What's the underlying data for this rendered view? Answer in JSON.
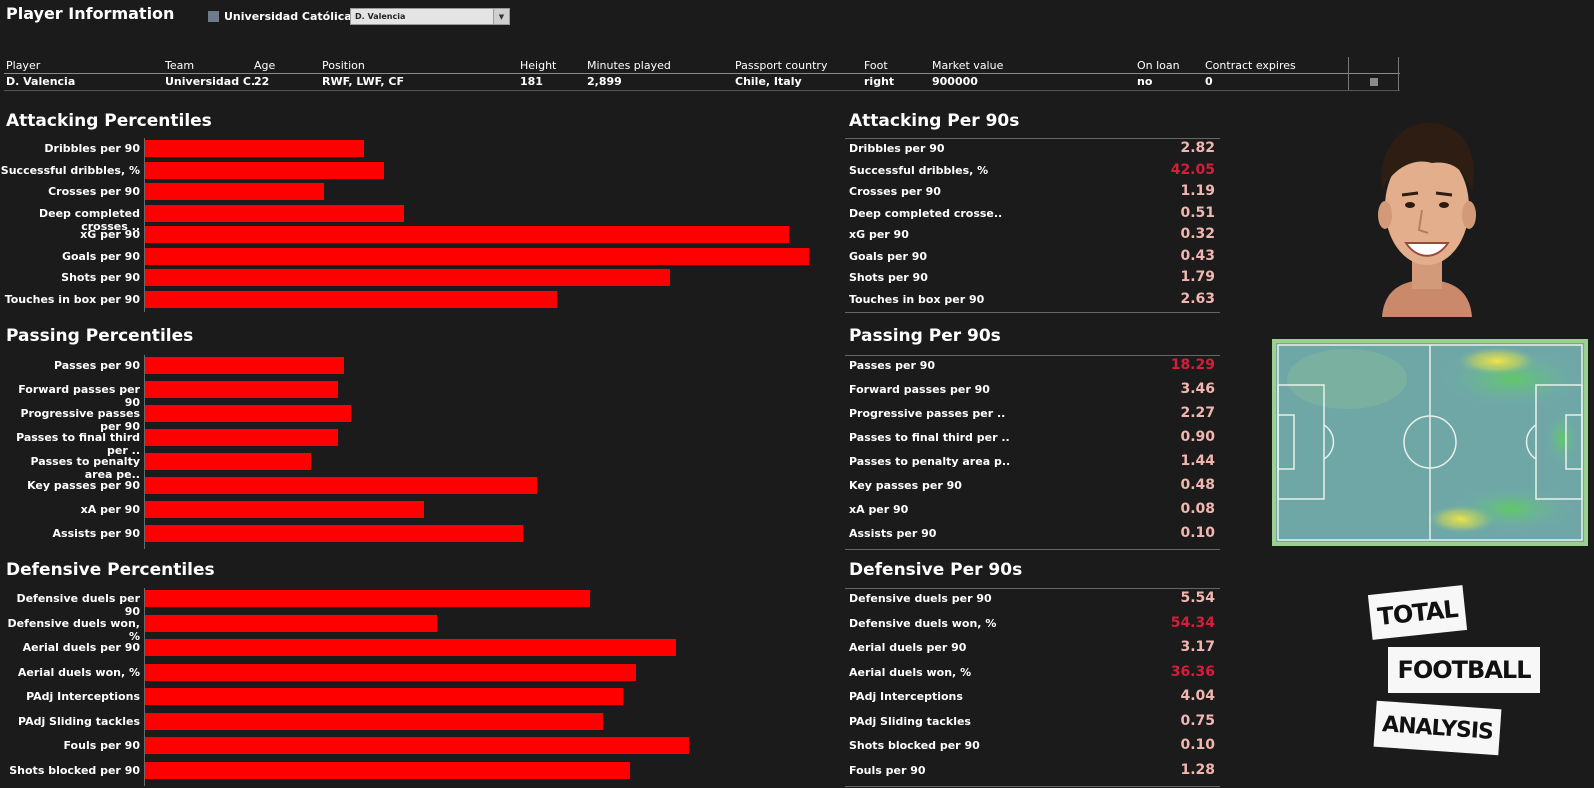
{
  "page_title": "Player Information",
  "team_filter": {
    "label": "Universidad Católica",
    "color": "#6d7b8a"
  },
  "player_select": {
    "value": "D. Valencia"
  },
  "info": {
    "headers": [
      "Player",
      "Team",
      "Age",
      "Position",
      "Height",
      "Minutes played",
      "Passport country",
      "Foot",
      "Market value",
      "On loan",
      "Contract expires"
    ],
    "values": [
      "D. Valencia",
      "Universidad C..",
      "22",
      "RWF, LWF, CF",
      "181",
      "2,899",
      "Chile, Italy",
      "right",
      "900000",
      "no",
      "0"
    ]
  },
  "attacking": {
    "title": "Attacking Percentiles",
    "per90_title": "Attacking Per 90s",
    "rows": [
      {
        "label": "Dribbles per 90",
        "pct": 0.33,
        "p90_label": "Dribbles per 90",
        "value": "2.82",
        "color": "#f2b6b0"
      },
      {
        "label": "Successful dribbles, %",
        "pct": 0.36,
        "p90_label": "Successful dribbles, %",
        "value": "42.05",
        "color": "#d41e3a"
      },
      {
        "label": "Crosses per 90",
        "pct": 0.27,
        "p90_label": "Crosses per 90",
        "value": "1.19",
        "color": "#f2b6b0"
      },
      {
        "label": "Deep completed crosses ..",
        "pct": 0.39,
        "p90_label": "Deep completed crosse..",
        "value": "0.51",
        "color": "#f2b6b0"
      },
      {
        "label": "xG per 90",
        "pct": 0.97,
        "p90_label": "xG per 90",
        "value": "0.32",
        "color": "#f2b6b0"
      },
      {
        "label": "Goals per 90",
        "pct": 1.0,
        "p90_label": "Goals per 90",
        "value": "0.43",
        "color": "#f2b6b0"
      },
      {
        "label": "Shots per 90",
        "pct": 0.79,
        "p90_label": "Shots per 90",
        "value": "1.79",
        "color": "#f2b6b0"
      },
      {
        "label": "Touches in box per 90",
        "pct": 0.62,
        "p90_label": "Touches in box per 90",
        "value": "2.63",
        "color": "#f2b6b0"
      }
    ]
  },
  "passing": {
    "title": "Passing Percentiles",
    "per90_title": "Passing Per 90s",
    "rows": [
      {
        "label": "Passes per 90",
        "pct": 0.3,
        "p90_label": "Passes per 90",
        "value": "18.29",
        "color": "#d41e3a"
      },
      {
        "label": "Forward passes per 90",
        "pct": 0.29,
        "p90_label": "Forward passes per 90",
        "value": "3.46",
        "color": "#f2b6b0"
      },
      {
        "label": "Progressive passes per 90",
        "pct": 0.31,
        "p90_label": "Progressive passes per ..",
        "value": "2.27",
        "color": "#f2b6b0"
      },
      {
        "label": "Passes to final third per ..",
        "pct": 0.29,
        "p90_label": "Passes to final third per ..",
        "value": "0.90",
        "color": "#f2b6b0"
      },
      {
        "label": "Passes to penalty area pe..",
        "pct": 0.25,
        "p90_label": "Passes to penalty area p..",
        "value": "1.44",
        "color": "#f2b6b0"
      },
      {
        "label": "Key passes per 90",
        "pct": 0.59,
        "p90_label": "Key passes per 90",
        "value": "0.48",
        "color": "#f2b6b0"
      },
      {
        "label": "xA per 90",
        "pct": 0.42,
        "p90_label": "xA per 90",
        "value": "0.08",
        "color": "#f2b6b0"
      },
      {
        "label": "Assists per 90",
        "pct": 0.57,
        "p90_label": "Assists per 90",
        "value": "0.10",
        "color": "#f2b6b0"
      }
    ]
  },
  "defensive": {
    "title": "Defensive Percentiles",
    "per90_title": "Defensive Per 90s",
    "rows": [
      {
        "label": "Defensive duels per 90",
        "pct": 0.67,
        "p90_label": "Defensive duels per 90",
        "value": "5.54",
        "color": "#f2b6b0"
      },
      {
        "label": "Defensive duels won, %",
        "pct": 0.44,
        "p90_label": "Defensive duels won, %",
        "value": "54.34",
        "color": "#d41e3a"
      },
      {
        "label": "Aerial duels per 90",
        "pct": 0.8,
        "p90_label": "Aerial duels per 90",
        "value": "3.17",
        "color": "#f2b6b0"
      },
      {
        "label": "Aerial duels won, %",
        "pct": 0.74,
        "p90_label": "Aerial duels won, %",
        "value": "36.36",
        "color": "#d41e3a"
      },
      {
        "label": "PAdj Interceptions",
        "pct": 0.72,
        "p90_label": "PAdj Interceptions",
        "value": "4.04",
        "color": "#f2b6b0"
      },
      {
        "label": "PAdj Sliding tackles",
        "pct": 0.69,
        "p90_label": "PAdj Sliding tackles",
        "value": "0.75",
        "color": "#f2b6b0"
      },
      {
        "label": "Fouls per 90",
        "pct": 0.82,
        "p90_label": "Shots blocked per 90",
        "value": "0.10",
        "color": "#f2b6b0"
      },
      {
        "label": "Shots blocked per 90",
        "pct": 0.73,
        "p90_label": "Fouls per 90",
        "value": "1.28",
        "color": "#f2b6b0"
      }
    ]
  },
  "logo": {
    "line1": "TOTAL",
    "line2": "FOOTBALL",
    "line3": "ANALYSIS"
  },
  "colors": {
    "bar": "#ff0000",
    "background": "#1b1b1b"
  }
}
